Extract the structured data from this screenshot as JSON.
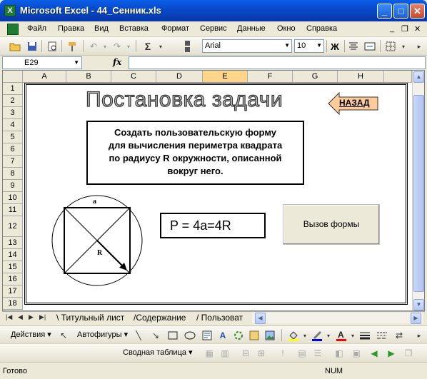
{
  "window": {
    "title": "Microsoft Excel - 44_Сенник.xls"
  },
  "menu": {
    "items": [
      "Файл",
      "Правка",
      "Вид",
      "Вставка",
      "Формат",
      "Сервис",
      "Данные",
      "Окно",
      "Справка"
    ]
  },
  "toolbar": {
    "font": "Arial",
    "size": "10",
    "bold": "Ж",
    "sigma": "Σ"
  },
  "formula_bar": {
    "cell_ref": "E29",
    "fx": "fx",
    "value": ""
  },
  "grid": {
    "columns": [
      "A",
      "B",
      "C",
      "D",
      "E",
      "F",
      "G",
      "H"
    ],
    "selected_column": "E",
    "rows": [
      "1",
      "2",
      "3",
      "4",
      "5",
      "6",
      "7",
      "8",
      "9",
      "10",
      "11",
      "12",
      "13",
      "14",
      "15",
      "16",
      "17",
      "18"
    ]
  },
  "sheet": {
    "heading": "Постановка задачи",
    "back_button": "НАЗАД",
    "task_text_lines": [
      "Создать пользовательскую форму",
      "для вычисления периметра квадрата",
      "по радиусу R окружности, описанной",
      "вокруг него."
    ],
    "formula": "P = 4a=4R",
    "form_button": "Вызов формы",
    "diagram_label_side": "a",
    "diagram_label_radius": "R"
  },
  "tabs": {
    "items": [
      "Титульный лист",
      "Содержание",
      "Пользоват"
    ]
  },
  "drawing_toolbar": {
    "actions": "Действия",
    "autoshapes": "Автофигуры"
  },
  "pivot_toolbar": {
    "pivot": "Сводная таблица"
  },
  "status": {
    "ready": "Готово",
    "num": "NUM"
  },
  "colors": {
    "title_bar": "#0A5FE8",
    "back_arrow": "#FFCC99",
    "selected_header": "#FFD58A"
  }
}
